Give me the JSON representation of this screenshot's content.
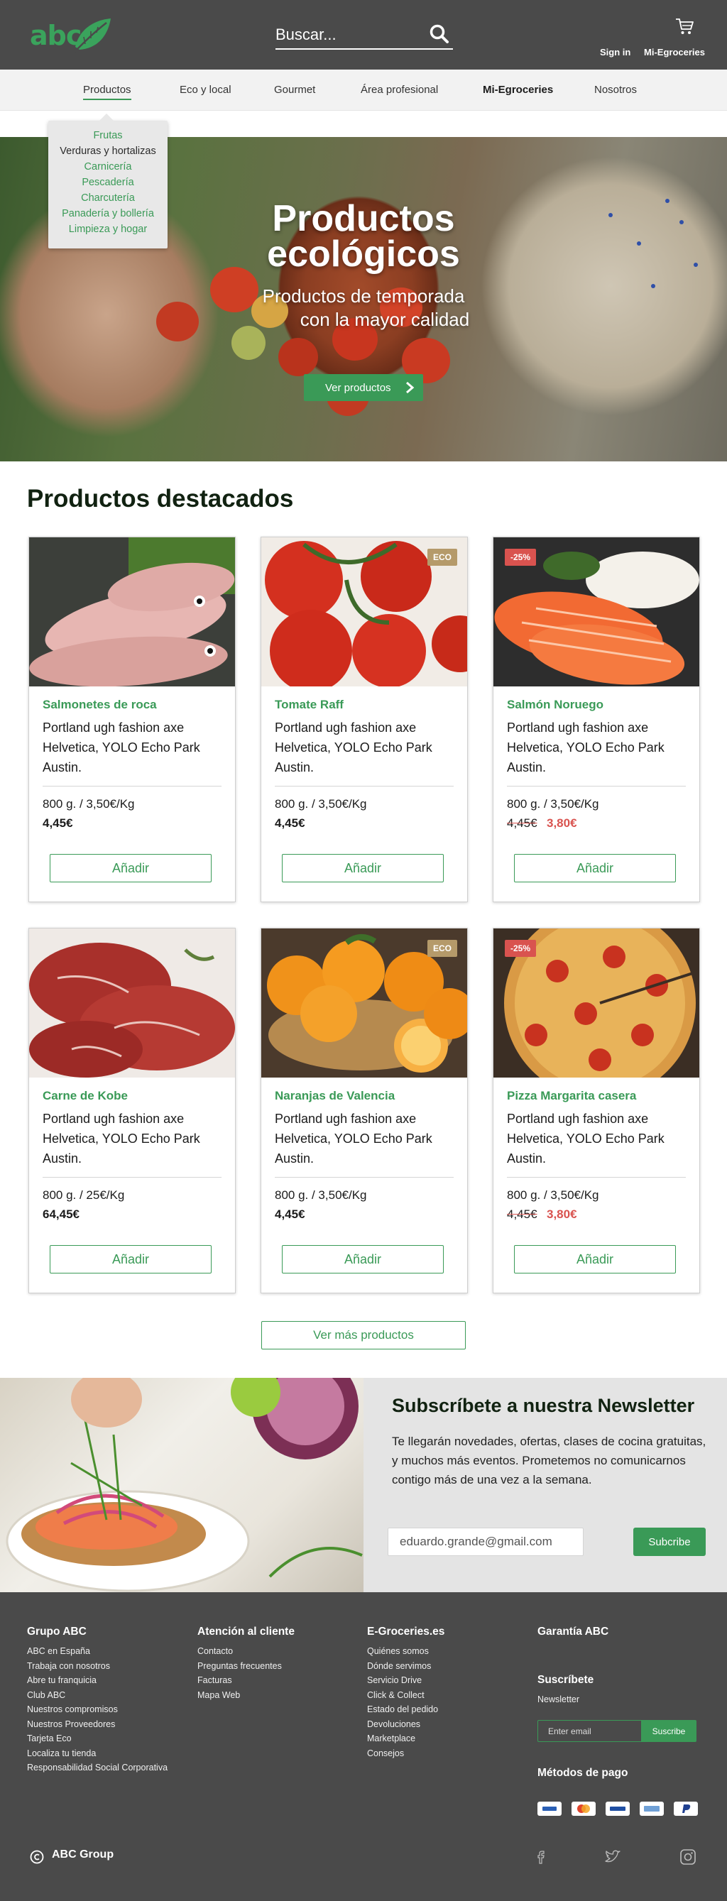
{
  "header": {
    "logo_text": "abc",
    "search_placeholder": "Buscar...",
    "signin": "Sign in",
    "account": "Mi-Egroceries"
  },
  "nav": {
    "items": [
      "Productos",
      "Eco y local",
      "Gourmet",
      "Área profesional",
      "Mi-Egroceries",
      "Nosotros"
    ],
    "dropdown": [
      "Frutas",
      "Verduras y hortalizas",
      "Carnicería",
      "Pescadería",
      "Charcutería",
      "Panadería y bollería",
      "Limpieza y hogar"
    ]
  },
  "hero": {
    "title_line1": "Productos",
    "title_line2": "ecológicos",
    "sub_line1": "Productos de temporada",
    "sub_line2": "con la mayor calidad",
    "button": "Ver productos"
  },
  "products": {
    "title": "Productos destacados",
    "add_label": "Añadir",
    "more_label": "Ver más productos",
    "items": [
      {
        "name": "Salmonetes de roca",
        "desc": "Portland ugh fashion axe Helvetica, YOLO Echo Park Austin.",
        "weight": "800 g. / 3,50€/Kg",
        "price": "4,45€",
        "old_price": "",
        "new_price": "",
        "badge": ""
      },
      {
        "name": "Tomate Raff",
        "desc": "Portland ugh fashion axe Helvetica, YOLO Echo Park Austin.",
        "weight": "800 g. / 3,50€/Kg",
        "price": "4,45€",
        "old_price": "",
        "new_price": "",
        "badge": "ECO"
      },
      {
        "name": "Salmón Noruego",
        "desc": "Portland ugh fashion axe Helvetica, YOLO Echo Park Austin.",
        "weight": "800 g. / 3,50€/Kg",
        "price": "",
        "old_price": "4,45€",
        "new_price": "3,80€",
        "badge": "-25%"
      },
      {
        "name": "Carne de Kobe",
        "desc": "Portland ugh fashion axe Helvetica, YOLO Echo Park Austin.",
        "weight": "800 g. / 25€/Kg",
        "price": "64,45€",
        "old_price": "",
        "new_price": "",
        "badge": ""
      },
      {
        "name": "Naranjas de Valencia",
        "desc": "Portland ugh fashion axe Helvetica, YOLO Echo Park Austin.",
        "weight": "800 g. / 3,50€/Kg",
        "price": "4,45€",
        "old_price": "",
        "new_price": "",
        "badge": "ECO"
      },
      {
        "name": "Pizza Margarita casera",
        "desc": "Portland ugh fashion axe Helvetica, YOLO Echo Park Austin.",
        "weight": "800 g. / 3,50€/Kg",
        "price": "",
        "old_price": "4,45€",
        "new_price": "3,80€",
        "badge": "-25%"
      }
    ]
  },
  "newsletter": {
    "title": "Subscríbete a nuestra Newsletter",
    "text": "Te llegarán novedades, ofertas, clases de cocina gratuitas, y muchos más eventos. Prometemos no comunicarnos contigo más de una vez a la semana.",
    "email_value": "eduardo.grande@gmail.com",
    "button": "Subcribe"
  },
  "footer": {
    "col1": {
      "title": "Grupo ABC",
      "links": [
        "ABC en España",
        "Trabaja con nosotros",
        "Abre tu franquicia",
        "Club ABC",
        "Nuestros compromisos",
        "Nuestros Proveedores",
        "Tarjeta Eco",
        "Localiza tu tienda",
        "Responsabilidad Social Corporativa"
      ]
    },
    "col2": {
      "title": "Atención al cliente",
      "links": [
        "Contacto",
        "Preguntas frecuentes",
        "Facturas",
        "Mapa Web"
      ]
    },
    "col3": {
      "title": "E-Groceries.es",
      "links": [
        "Quiénes somos",
        "Dónde servimos",
        "Servicio Drive",
        "Click & Collect",
        "Estado del pedido",
        "Devoluciones",
        "Marketplace",
        "Consejos"
      ]
    },
    "guarantee": "Garantía ABC",
    "subscribe_title": "Suscríbete",
    "subscribe_label": "Newsletter",
    "email_placeholder": "Enter email",
    "subscribe_button": "Suscribe",
    "payments_title": "Métodos de pago",
    "copyright": "ABC Group"
  },
  "colors": {
    "brand_green": "#3a9a57",
    "discount_red": "#d9534f",
    "eco_badge": "#b59a6a",
    "header_bg": "#4a4a4a"
  }
}
